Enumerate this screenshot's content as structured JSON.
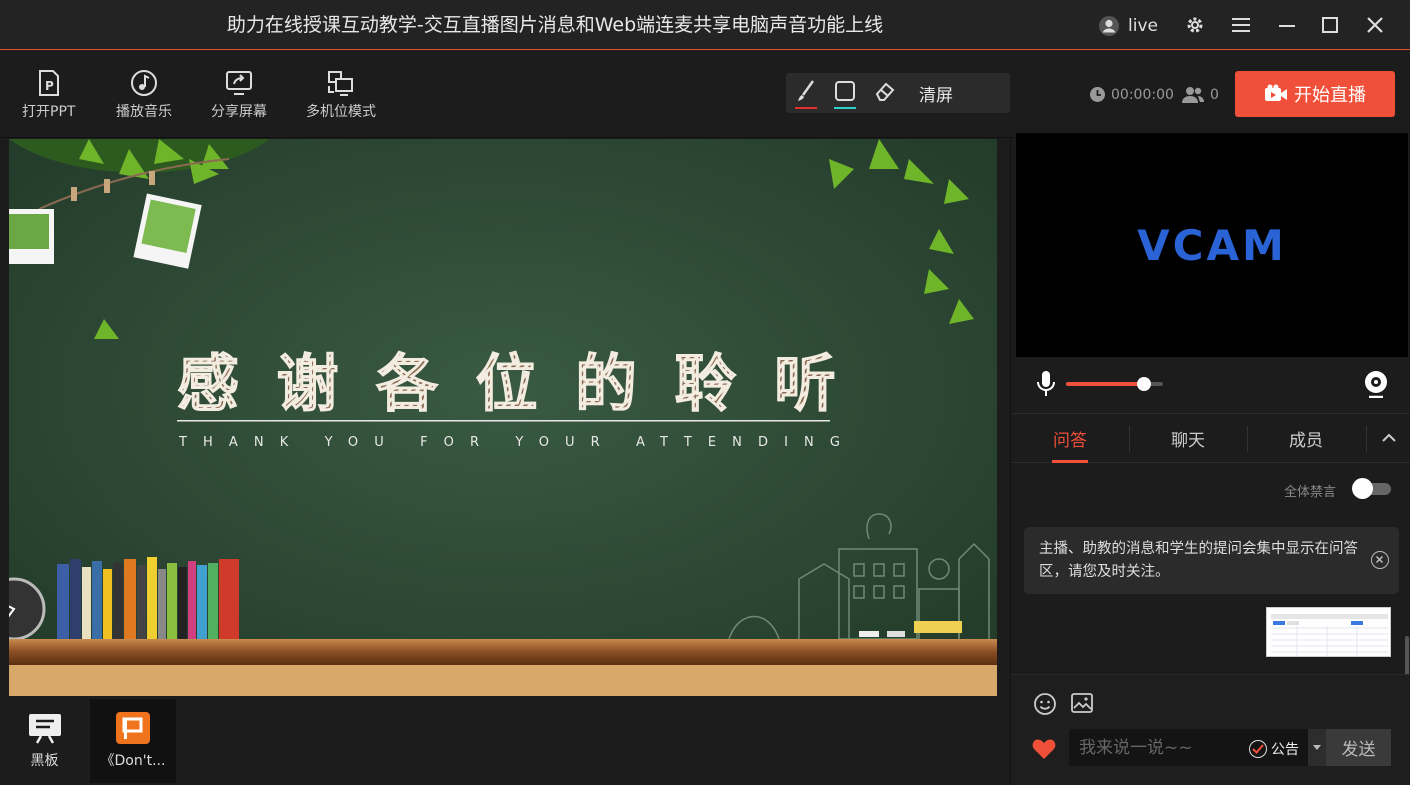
{
  "window": {
    "title": "助力在线授课互动教学-交互直播图片消息和Web端连麦共享电脑声音功能上线",
    "user_name": "live",
    "buttons": {
      "settings": "gear-icon",
      "menu": "menu-icon",
      "minimize": "minimize-icon",
      "maximize": "maximize-icon",
      "close": "close-icon"
    }
  },
  "toolbar": {
    "tools": [
      {
        "label": "打开PPT",
        "icon": "ppt-file-icon"
      },
      {
        "label": "播放音乐",
        "icon": "music-icon"
      },
      {
        "label": "分享屏幕",
        "icon": "share-screen-icon"
      },
      {
        "label": "多机位模式",
        "icon": "multi-camera-icon"
      }
    ],
    "draw": {
      "pen_color": "#e03030",
      "shape_color": "#2fd0c8",
      "clear_label": "清屏"
    },
    "timer": "00:00:00",
    "viewer_count": "0",
    "start_live_label": "开始直播"
  },
  "slide": {
    "title_chars": [
      "感",
      "谢",
      "各",
      "位",
      "的",
      "聆",
      "听"
    ],
    "subtitle": "THANK YOU FOR YOUR ATTENDING"
  },
  "thumbnails": [
    {
      "label": "黑板",
      "icon": "blackboard-icon"
    },
    {
      "label": "《Don't...",
      "icon": "ppt-icon"
    }
  ],
  "sidebar": {
    "video_text": "VCAM",
    "mic_volume_percent": 80,
    "tabs": [
      "问答",
      "聊天",
      "成员"
    ],
    "active_tab": "问答",
    "mute_all_label": "全体禁言",
    "mute_all_on": false,
    "notice_text": "主播、助教的消息和学生的提问会集中显示在问答区，请您及时关注。",
    "input_placeholder": "我来说一说~~",
    "announce_label": "公告",
    "send_label": "发送"
  },
  "colors": {
    "accent": "#f0503a",
    "vcam_blue": "#2a63d6",
    "board_green": "#2d4a35"
  }
}
